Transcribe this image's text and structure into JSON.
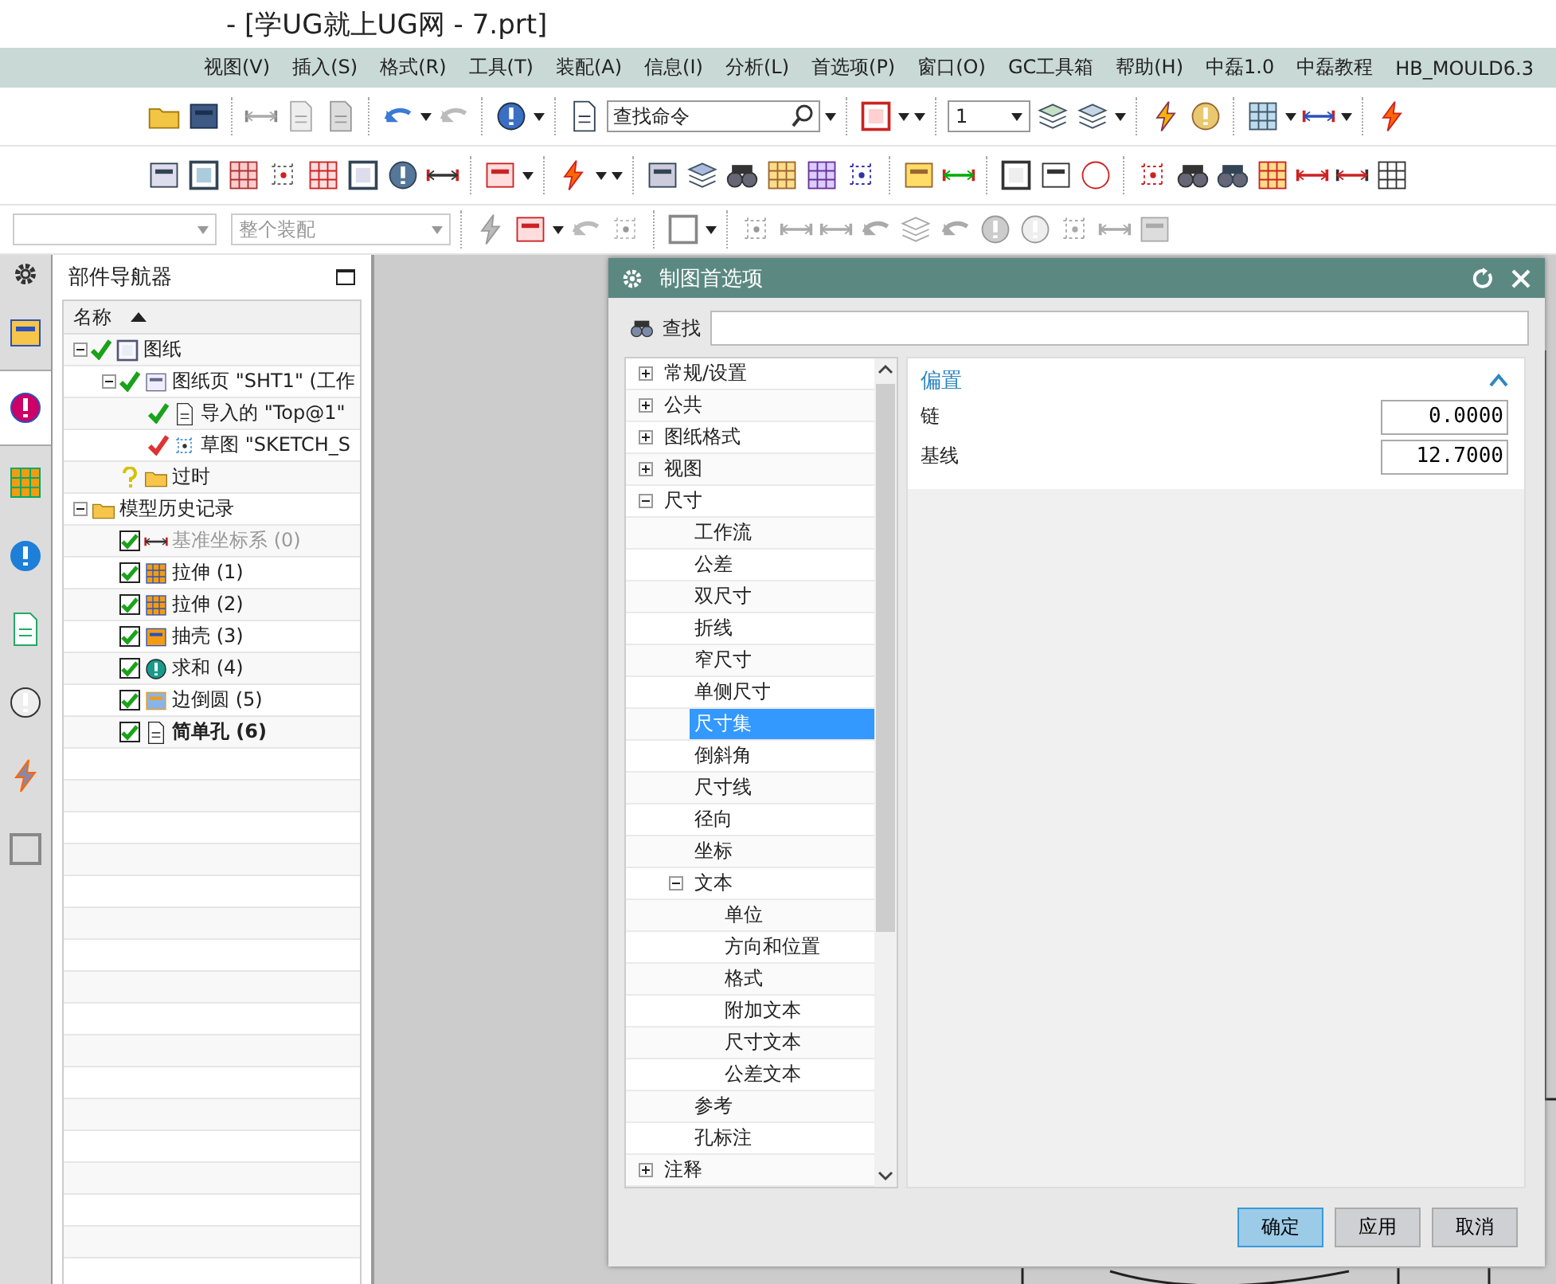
{
  "title_bar": {
    "title": "- [学UG就上UG网 - 7.prt]"
  },
  "menu_bar": {
    "items": [
      "视图(V)",
      "插入(S)",
      "格式(R)",
      "工具(T)",
      "装配(A)",
      "信息(I)",
      "分析(L)",
      "首选项(P)",
      "窗口(O)",
      "GC工具箱",
      "帮助(H)",
      "中磊1.0",
      "中磊教程",
      "HB_MOULD6.3"
    ]
  },
  "toolbar": {
    "command_search": {
      "placeholder": "查找命令"
    },
    "layer_dropdown": {
      "value": "1"
    },
    "scope_dropdown": {
      "value": "整个装配",
      "disabled": true
    }
  },
  "resource_bar": {
    "tabs": [
      {
        "selected": false
      },
      {
        "selected": true
      },
      {
        "selected": false
      },
      {
        "selected": false
      },
      {
        "selected": false
      },
      {
        "selected": false
      },
      {
        "selected": false
      },
      {
        "selected": false
      }
    ]
  },
  "part_navigator": {
    "title": "部件导航器",
    "column": "名称",
    "tree": [
      {
        "label": "图纸",
        "kind": "check",
        "color": "#1aa31a",
        "expanded": true,
        "dimmed": false,
        "current": false,
        "children": [
          {
            "label": "图纸页 \"SHT1\" (工作",
            "kind": "check",
            "color": "#1aa31a",
            "expanded": true,
            "dimmed": false,
            "current": false,
            "children": [
              {
                "label": "导入的 \"Top@1\"",
                "kind": "check",
                "color": "#1aa31a",
                "dimmed": false,
                "current": false
              },
              {
                "label": "草图 \"SKETCH_S",
                "kind": "check",
                "color": "#dd3333",
                "dimmed": false,
                "current": false
              }
            ]
          },
          {
            "label": "过时",
            "kind": "question",
            "dimmed": false,
            "current": false
          }
        ]
      },
      {
        "label": "模型历史记录",
        "kind": "plain",
        "expanded": true,
        "dimmed": false,
        "current": false,
        "children": [
          {
            "label": "基准坐标系 (0)",
            "kind": "checkbox",
            "checked": true,
            "dimmed": true,
            "current": false
          },
          {
            "label": "拉伸 (1)",
            "kind": "checkbox",
            "checked": true,
            "dimmed": false,
            "current": false
          },
          {
            "label": "拉伸 (2)",
            "kind": "checkbox",
            "checked": true,
            "dimmed": false,
            "current": false
          },
          {
            "label": "抽壳 (3)",
            "kind": "checkbox",
            "checked": true,
            "dimmed": false,
            "current": false
          },
          {
            "label": "求和 (4)",
            "kind": "checkbox",
            "checked": true,
            "dimmed": false,
            "current": false
          },
          {
            "label": "边倒圆 (5)",
            "kind": "checkbox",
            "checked": true,
            "dimmed": false,
            "current": false
          },
          {
            "label": "简单孔 (6)",
            "kind": "checkbox",
            "checked": true,
            "dimmed": false,
            "current": true
          }
        ]
      }
    ]
  },
  "dialog": {
    "title": "制图首选项",
    "search_label": "查找",
    "tree": [
      {
        "label": "常规/设置",
        "expanded": false,
        "selected": false
      },
      {
        "label": "公共",
        "expanded": false,
        "selected": false
      },
      {
        "label": "图纸格式",
        "expanded": false,
        "selected": false
      },
      {
        "label": "视图",
        "expanded": false,
        "selected": false
      },
      {
        "label": "尺寸",
        "expanded": true,
        "selected": false,
        "children": [
          {
            "label": "工作流",
            "selected": false
          },
          {
            "label": "公差",
            "selected": false
          },
          {
            "label": "双尺寸",
            "selected": false
          },
          {
            "label": "折线",
            "selected": false
          },
          {
            "label": "窄尺寸",
            "selected": false
          },
          {
            "label": "单侧尺寸",
            "selected": false
          },
          {
            "label": "尺寸集",
            "selected": true
          },
          {
            "label": "倒斜角",
            "selected": false
          },
          {
            "label": "尺寸线",
            "selected": false
          },
          {
            "label": "径向",
            "selected": false
          },
          {
            "label": "坐标",
            "selected": false
          },
          {
            "label": "文本",
            "expanded": true,
            "selected": false,
            "children": [
              {
                "label": "单位",
                "selected": false
              },
              {
                "label": "方向和位置",
                "selected": false
              },
              {
                "label": "格式",
                "selected": false
              },
              {
                "label": "附加文本",
                "selected": false
              },
              {
                "label": "尺寸文本",
                "selected": false
              },
              {
                "label": "公差文本",
                "selected": false
              }
            ]
          },
          {
            "label": "参考",
            "selected": false
          },
          {
            "label": "孔标注",
            "selected": false
          }
        ]
      },
      {
        "label": "注释",
        "expanded": false,
        "selected": false
      }
    ],
    "section": {
      "title": "偏置",
      "expanded": true,
      "fields": [
        {
          "label": "链",
          "value": "0.0000"
        },
        {
          "label": "基线",
          "value": "12.7000"
        }
      ]
    },
    "buttons": [
      {
        "label": "确定",
        "default": true
      },
      {
        "label": "应用",
        "default": false
      },
      {
        "label": "取消",
        "default": false
      }
    ]
  }
}
